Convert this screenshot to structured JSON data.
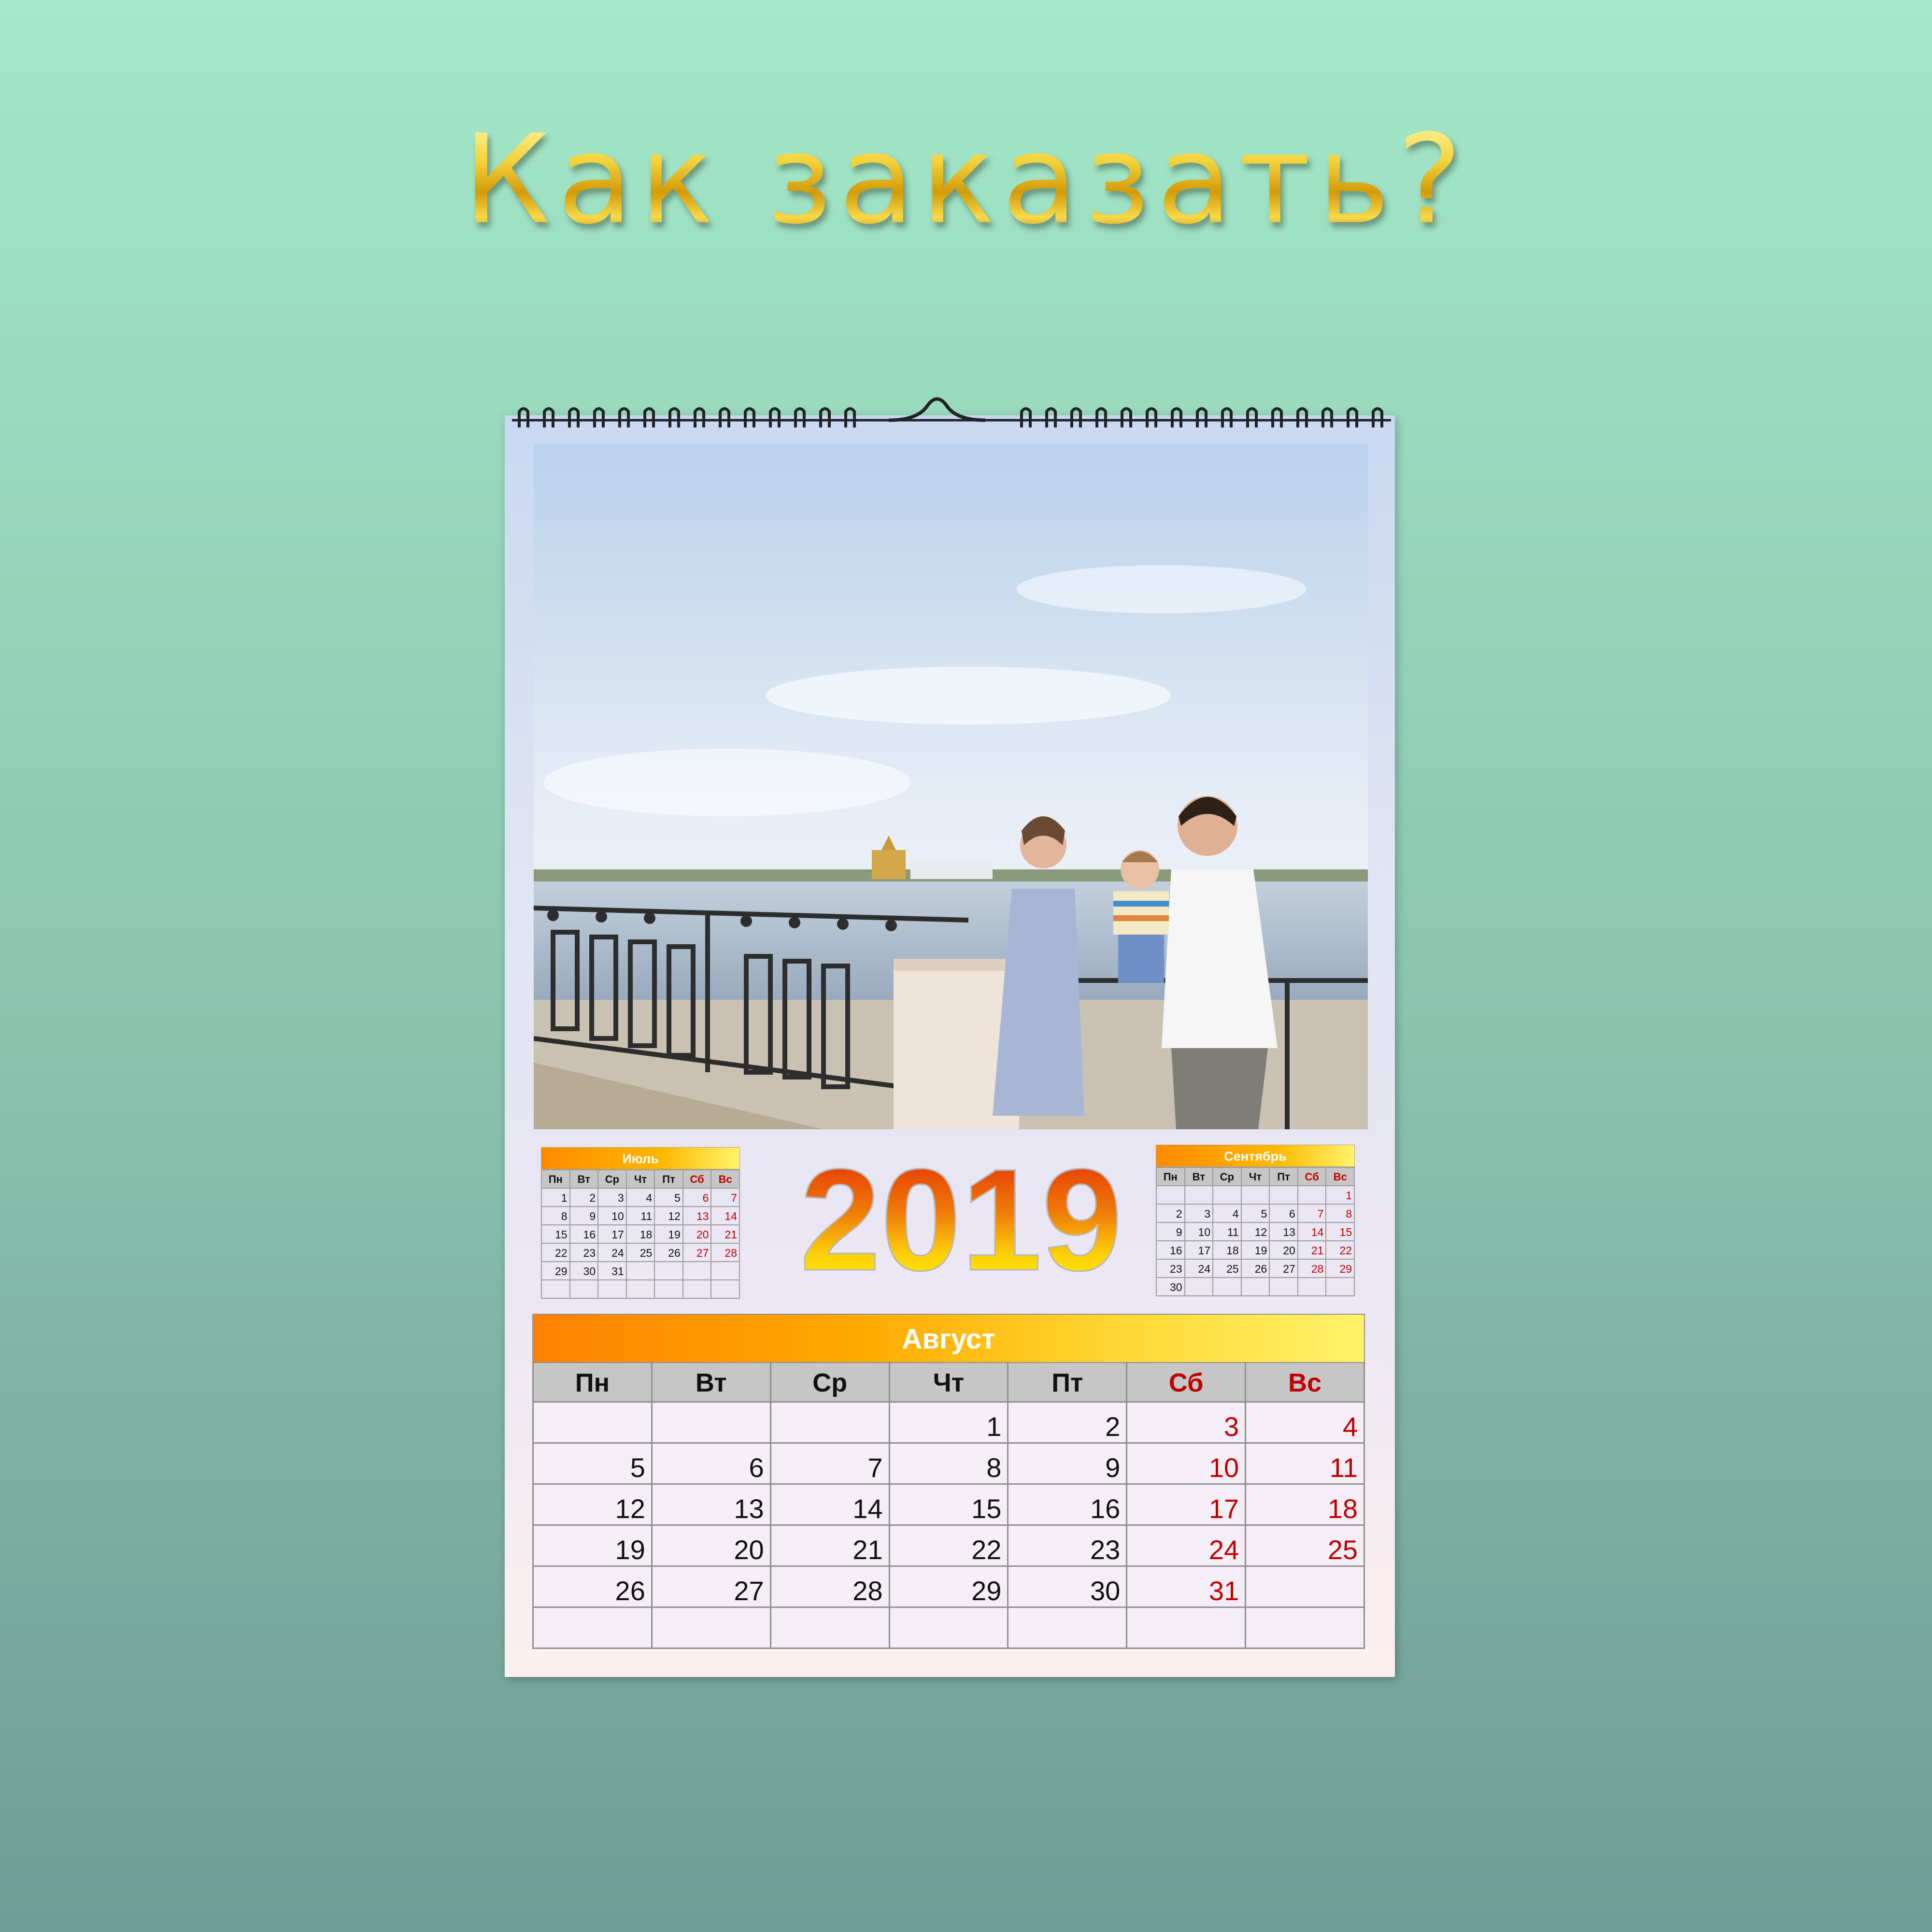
{
  "headline": "Как заказать?",
  "year": "2019",
  "weekdays": [
    "Пн",
    "Вт",
    "Ср",
    "Чт",
    "Пт",
    "Сб",
    "Вс"
  ],
  "july": {
    "title": "Июль",
    "weeks": [
      [
        "1",
        "2",
        "3",
        "4",
        "5",
        "6",
        "7"
      ],
      [
        "8",
        "9",
        "10",
        "11",
        "12",
        "13",
        "14"
      ],
      [
        "15",
        "16",
        "17",
        "18",
        "19",
        "20",
        "21"
      ],
      [
        "22",
        "23",
        "24",
        "25",
        "26",
        "27",
        "28"
      ],
      [
        "29",
        "30",
        "31",
        "",
        "",
        "",
        ""
      ],
      [
        "",
        "",
        "",
        "",
        "",
        "",
        ""
      ]
    ]
  },
  "september": {
    "title": "Сентябрь",
    "weeks": [
      [
        "",
        "",
        "",
        "",
        "",
        "",
        "1"
      ],
      [
        "2",
        "3",
        "4",
        "5",
        "6",
        "7",
        "8"
      ],
      [
        "9",
        "10",
        "11",
        "12",
        "13",
        "14",
        "15"
      ],
      [
        "16",
        "17",
        "18",
        "19",
        "20",
        "21",
        "22"
      ],
      [
        "23",
        "24",
        "25",
        "26",
        "27",
        "28",
        "29"
      ],
      [
        "30",
        "",
        "",
        "",
        "",
        "",
        ""
      ]
    ]
  },
  "august": {
    "title": "Август",
    "weeks": [
      [
        "",
        "",
        "",
        "1",
        "2",
        "3",
        "4"
      ],
      [
        "5",
        "6",
        "7",
        "8",
        "9",
        "10",
        "11"
      ],
      [
        "12",
        "13",
        "14",
        "15",
        "16",
        "17",
        "18"
      ],
      [
        "19",
        "20",
        "21",
        "22",
        "23",
        "24",
        "25"
      ],
      [
        "26",
        "27",
        "28",
        "29",
        "30",
        "31",
        ""
      ],
      [
        "",
        "",
        "",
        "",
        "",
        "",
        ""
      ]
    ]
  },
  "colors": {
    "weekend": "#c00000",
    "header_gradient_start": "#ff8200",
    "header_gradient_end": "#fff26a",
    "background_top": "#a3e8c9",
    "background_bottom": "#6f9c96"
  }
}
